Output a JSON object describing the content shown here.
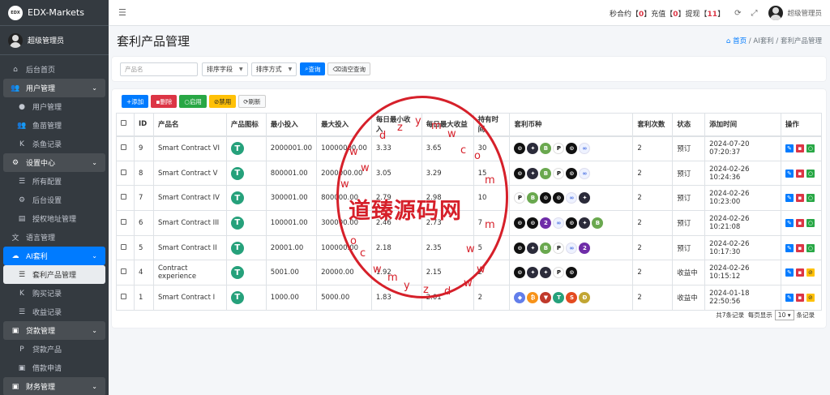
{
  "app": {
    "brand": "EDX-Markets",
    "brand_logo": "EDX",
    "user": "超级管理员"
  },
  "sidebar": {
    "items": [
      {
        "label": "后台首页",
        "icon": "home-icon",
        "type": "top"
      },
      {
        "label": "用户管理",
        "icon": "users-icon",
        "type": "header"
      },
      {
        "label": "用户管理",
        "icon": "user-icon",
        "type": "sub"
      },
      {
        "label": "鱼苗管理",
        "icon": "users-icon",
        "type": "sub"
      },
      {
        "label": "杀鱼记录",
        "icon": "k-icon",
        "type": "sub"
      },
      {
        "label": "设置中心",
        "icon": "gears-icon",
        "type": "header"
      },
      {
        "label": "所有配置",
        "icon": "list-icon",
        "type": "sub"
      },
      {
        "label": "后台设置",
        "icon": "gear-icon",
        "type": "sub"
      },
      {
        "label": "授权地址管理",
        "icon": "clipboard-icon",
        "type": "sub"
      },
      {
        "label": "语言管理",
        "icon": "language-icon",
        "type": "top"
      },
      {
        "label": "AI套利",
        "icon": "ai-icon",
        "type": "active"
      },
      {
        "label": "套利产品管理",
        "icon": "list-icon",
        "type": "current"
      },
      {
        "label": "购买记录",
        "icon": "k-icon",
        "type": "sub"
      },
      {
        "label": "收益记录",
        "icon": "list-icon",
        "type": "sub"
      },
      {
        "label": "贷款管理",
        "icon": "money-icon",
        "type": "header"
      },
      {
        "label": "贷款产品",
        "icon": "p-icon",
        "type": "sub"
      },
      {
        "label": "借款申请",
        "icon": "money-icon",
        "type": "sub"
      },
      {
        "label": "财务管理",
        "icon": "wallet-icon",
        "type": "header"
      }
    ]
  },
  "topbar": {
    "seg1": "秒合约【",
    "n1": "0",
    "seg2": "】充值【",
    "n2": "0",
    "seg3": "】提现【",
    "n3": "11",
    "seg4": "】",
    "user": "超级管理员"
  },
  "page": {
    "title": "套利产品管理",
    "crumb_home": "首页",
    "crumb_sep1": "/",
    "crumb_mid": "AI套利",
    "crumb_sep2": "/",
    "crumb_cur": "套利产品管理"
  },
  "search": {
    "name_placeholder": "产品名",
    "sort_field": "排序字段",
    "sort_way": "排序方式",
    "query": "查询",
    "clear": "清空查询"
  },
  "toolbar": {
    "add": "添加",
    "del": "删除",
    "enable": "启用",
    "disable": "禁用",
    "refresh": "刷新"
  },
  "table": {
    "headers": [
      "",
      "ID",
      "产品名",
      "产品图标",
      "最小投入",
      "最大投入",
      "每日最小收入",
      "每日最大收益",
      "持有时间",
      "套利币种",
      "套利次数",
      "状态",
      "添加时间",
      "操作"
    ],
    "rows": [
      {
        "id": "9",
        "name": "Smart Contract VI",
        "min": "2000001.00",
        "max": "10000000.00",
        "dmin": "3.33",
        "dmax": "3.65",
        "hold": "30",
        "times": "2",
        "status": "预订",
        "time": "2024-07-20 07:20:37",
        "coins": [
          "c-black",
          "c-dark",
          "c-green",
          "c-white",
          "c-black",
          "c-light"
        ],
        "ops": [
          "op-blue",
          "op-red",
          "op-green"
        ]
      },
      {
        "id": "8",
        "name": "Smart Contract V",
        "min": "800001.00",
        "max": "2000000.00",
        "dmin": "3.05",
        "dmax": "3.29",
        "hold": "15",
        "times": "2",
        "status": "预订",
        "time": "2024-02-26 10:24:36",
        "coins": [
          "c-black",
          "c-dark",
          "c-green",
          "c-white",
          "c-black",
          "c-light"
        ],
        "ops": [
          "op-blue",
          "op-red",
          "op-green"
        ]
      },
      {
        "id": "7",
        "name": "Smart Contract IV",
        "min": "300001.00",
        "max": "800000.00",
        "dmin": "2.79",
        "dmax": "2.98",
        "hold": "10",
        "times": "2",
        "status": "预订",
        "time": "2024-02-26 10:23:00",
        "coins": [
          "c-white",
          "c-green",
          "c-black",
          "c-black",
          "c-light",
          "c-dark"
        ],
        "ops": [
          "op-blue",
          "op-red",
          "op-green"
        ]
      },
      {
        "id": "6",
        "name": "Smart Contract III",
        "min": "100001.00",
        "max": "300000.00",
        "dmin": "2.46",
        "dmax": "2.73",
        "hold": "7",
        "times": "2",
        "status": "预订",
        "time": "2024-02-26 10:21:08",
        "coins": [
          "c-black",
          "c-black",
          "c-purple",
          "c-light",
          "c-black",
          "c-dark",
          "c-green"
        ],
        "ops": [
          "op-blue",
          "op-red",
          "op-green"
        ]
      },
      {
        "id": "5",
        "name": "Smart Contract II",
        "min": "20001.00",
        "max": "100000.00",
        "dmin": "2.18",
        "dmax": "2.35",
        "hold": "5",
        "times": "2",
        "status": "预订",
        "time": "2024-02-26 10:17:30",
        "coins": [
          "c-black",
          "c-dark",
          "c-green",
          "c-white",
          "c-light",
          "c-purple"
        ],
        "ops": [
          "op-blue",
          "op-red",
          "op-green"
        ]
      },
      {
        "id": "4",
        "name": "Contract experience",
        "min": "5001.00",
        "max": "20000.00",
        "dmin": "1.92",
        "dmax": "2.15",
        "hold": "2",
        "times": "2",
        "status": "收益中",
        "time": "2024-02-26 10:15:12",
        "coins": [
          "c-black",
          "c-dark",
          "c-dark",
          "c-white",
          "c-black"
        ],
        "ops": [
          "op-blue",
          "op-red",
          "op-yellow"
        ]
      },
      {
        "id": "1",
        "name": "Smart Contract I",
        "min": "1000.00",
        "max": "5000.00",
        "dmin": "1.83",
        "dmax": "2.01",
        "hold": "2",
        "times": "2",
        "status": "收益中",
        "time": "2024-01-18 22:50:56",
        "coins": [
          "c-blue",
          "c-orange",
          "c-red",
          "c-teal",
          "c-shib",
          "c-doge"
        ],
        "ops": [
          "op-blue",
          "op-red",
          "op-yellow"
        ]
      }
    ]
  },
  "pager": {
    "total": "共7条记录",
    "per": "每页显示",
    "per_val": "10",
    "unit": "条记录"
  },
  "watermark": {
    "text": "道臻源码网",
    "letters": "wwwdzymwcom"
  }
}
